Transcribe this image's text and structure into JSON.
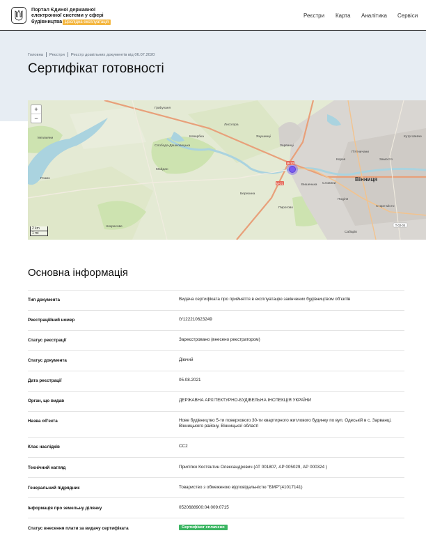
{
  "header": {
    "brand_line1": "Портал Єдиної державної",
    "brand_line2": "електронної системи у сфері",
    "brand_line3": "будівництва",
    "badge": "Дослідна експлуатація",
    "nav": [
      "Реєстри",
      "Карта",
      "Аналітика",
      "Сервіси"
    ]
  },
  "breadcrumbs": [
    "Головна",
    "Реєстри",
    "Реєстр дозвільних документів від 06.07.2020"
  ],
  "page_title": "Сертифікат готовності",
  "map": {
    "zoom_in": "+",
    "zoom_out": "−",
    "scale_km": "2 km",
    "scale_mi": "1 mi",
    "labels": {
      "l1": "Гриbуvaня",
      "l2": "Мезлияни",
      "l3": "Слобода-Дашковецька",
      "l4": "Ковербка",
      "l5": "Лисогора",
      "l6": "Якушинці",
      "l7": "Зарванці",
      "l8": "Майдан",
      "l9": "Рожик",
      "l10": "Березина",
      "l11": "Пирогово",
      "l12": "Корея",
      "l13": "Словяни",
      "l14": "Вінниця",
      "l15": "Подiля",
      "l16": "Старе місто",
      "l17": "Сабарів",
      "l18": "Некрасове",
      "l19": "Вишенька",
      "l20": "П'ятничани",
      "l21": "Замостя",
      "l22": "Кутр Шевче",
      "road1": "M-12",
      "road2": "M-21",
      "road3": "T-02-04"
    }
  },
  "section_title": "Основна інформація",
  "info": {
    "doc_type_label": "Тип документа",
    "doc_type_value": "Видача сертифіката про прийняття в експлуатацію закінчених будівництвом об'єктів",
    "reg_num_label": "Реєстраційний номер",
    "reg_num_value": "IУ122210623249",
    "reg_status_label": "Статус реєстрації",
    "reg_status_value": "Зареєстровано (внесено реєстратором)",
    "doc_status_label": "Статус документа",
    "doc_status_value": "Діючий",
    "reg_date_label": "Дата реєстрації",
    "reg_date_value": "05.08.2021",
    "issuer_label": "Орган, що видав",
    "issuer_value": "ДЕРЖАВНА АРХІТЕКТУРНО-БУДІВЕЛЬНА ІНСПЕКЦІЯ УКРАЇНИ",
    "object_label": "Назва об'єкта",
    "object_value": "Нове будівництво 5-ти поверхового 30-ти квартирного житлового будинку по вул. Одеській в с. Зарванці, Вінницького району, Вінницької області",
    "class_label": "Клас наслідків",
    "class_value": "СС2",
    "tech_label": "Технічний нагляд",
    "tech_value": "Приліпко Костянтин Олександрович (АТ 001807, АР 005029, АР 000324 )",
    "contractor_label": "Генеральний підрядник",
    "contractor_value": "Товариство з обмеженою відповідальністю \"БМР\"(41017141)",
    "land_label": "Інформація про земельну ділянку",
    "land_value": "0520688900:04:009:0715",
    "fee_label": "Статус внесення плати за видачу сертифіката",
    "fee_value": "Сертифікат сплачено"
  },
  "colors": {
    "badge_yellow": "#f4b63f",
    "badge_green": "#3bb562",
    "band": "#e7edf3",
    "marker": "#7a5cf0"
  }
}
